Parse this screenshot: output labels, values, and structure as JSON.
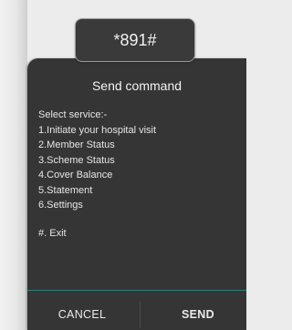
{
  "ussd_code": "*891#",
  "dialog": {
    "title": "Send command",
    "message_lines": [
      "Select service:-",
      "1.Initiate your hospital visit",
      "2.Member Status",
      "3.Scheme Status",
      "4.Cover Balance",
      "5.Statement",
      "6.Settings"
    ],
    "exit_line": "#. Exit",
    "cancel_label": "CANCEL",
    "send_label": "SEND"
  },
  "colors": {
    "dialog_background": "#353535",
    "divider_accent": "#2c7f7a"
  }
}
